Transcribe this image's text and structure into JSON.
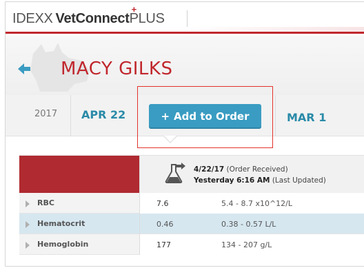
{
  "brand": {
    "idexx": "IDEXX",
    "vetconnect": "VetConnect",
    "plus": "PLUS"
  },
  "patient": {
    "name": "MACY GILKS"
  },
  "datebar": {
    "year": "2017",
    "selected_date": "APR 22",
    "next_date": "MAR 1",
    "add_button_icon": "+",
    "add_button_label": "Add to Order"
  },
  "order": {
    "date": "4/22/17",
    "status": "(Order Received)",
    "updated_time": "Yesterday 6:16 AM",
    "updated_label": "(Last Updated)"
  },
  "results": [
    {
      "name": "RBC",
      "value": "7.6",
      "range": "5.4 - 8.7 x10^12/L"
    },
    {
      "name": "Hematocrit",
      "value": "0.46",
      "range": "0.38 - 0.57 L/L"
    },
    {
      "name": "Hemoglobin",
      "value": "177",
      "range": "134 - 207 g/L"
    }
  ],
  "colors": {
    "brand_red": "#c0272d",
    "link_blue": "#2a8aa8",
    "button_blue": "#3a9cc2",
    "highlight_row": "#d6e7f0"
  },
  "icons": {
    "back": "back-arrow-icon",
    "flask": "flask-icon",
    "expand": "expand-triangle-icon"
  }
}
